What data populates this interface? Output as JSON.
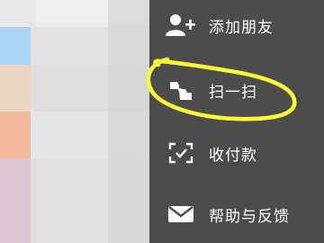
{
  "menu": {
    "items": [
      {
        "label": "添加朋友",
        "icon": "add-friend-icon"
      },
      {
        "label": "扫一扫",
        "icon": "scan-icon"
      },
      {
        "label": "收付款",
        "icon": "payment-scan-icon"
      },
      {
        "label": "帮助与反馈",
        "icon": "mail-icon"
      }
    ],
    "background": "#4c4c4c",
    "text_color": "#ffffff"
  },
  "annotation": {
    "color": "#ffff33",
    "target": "扫一扫"
  }
}
